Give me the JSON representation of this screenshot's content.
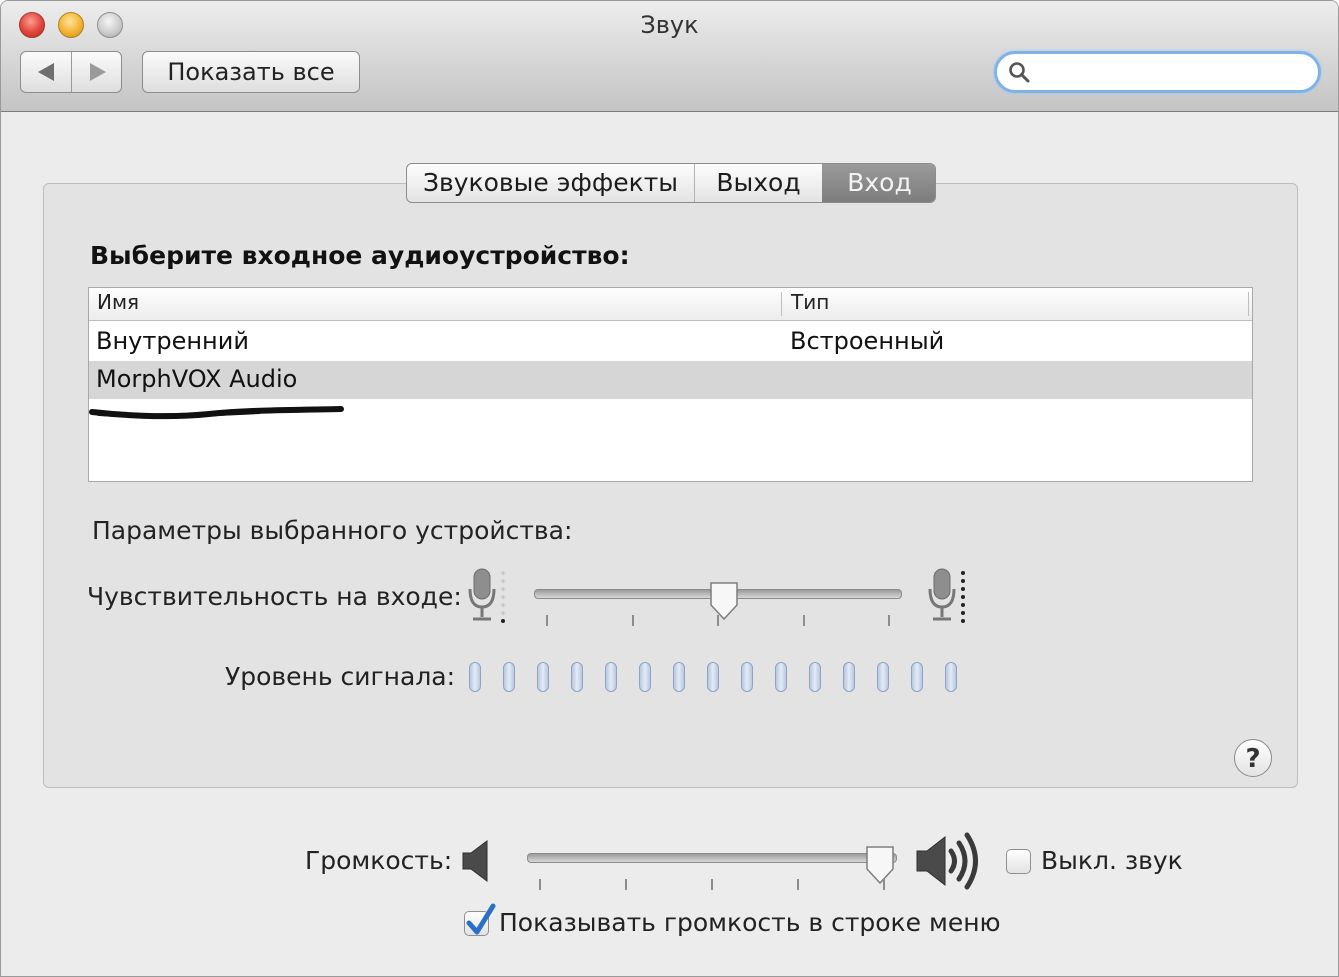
{
  "window": {
    "title": "Звук"
  },
  "toolbar": {
    "back_icon": "chevron-left-icon",
    "forward_icon": "chevron-right-icon",
    "show_all_label": "Показать все",
    "search_placeholder": "",
    "search_icon": "magnifier-icon"
  },
  "tabs": [
    {
      "label": "Звуковые эффекты",
      "selected": false
    },
    {
      "label": "Выход",
      "selected": false
    },
    {
      "label": "Вход",
      "selected": true
    }
  ],
  "input_panel": {
    "heading": "Выберите входное аудиоустройство:",
    "columns": {
      "name": "Имя",
      "type": "Тип"
    },
    "devices": [
      {
        "name": "Внутренний",
        "type": "Встроенный",
        "selected": false
      },
      {
        "name": "MorphVOX Audio",
        "type": "",
        "selected": true
      }
    ],
    "params_label": "Параметры выбранного устройства:",
    "sensitivity_label": "Чувствительность на входе:",
    "sensitivity_value": 0.52,
    "level_label": "Уровень сигнала:",
    "level_bars_total": 15,
    "level_bars_lit": 0
  },
  "output": {
    "volume_label": "Громкость:",
    "volume_value": 0.96,
    "mute_label": "Выкл. звук",
    "mute_checked": false,
    "show_in_menu_label": "Показывать громкость в строке меню",
    "show_in_menu_checked": true
  },
  "colors": {
    "selected_tab": "#8a8a8a",
    "selected_row": "#d6d6d6",
    "search_focus": "#7fb3e8",
    "checkmark": "#2a6fc9"
  }
}
